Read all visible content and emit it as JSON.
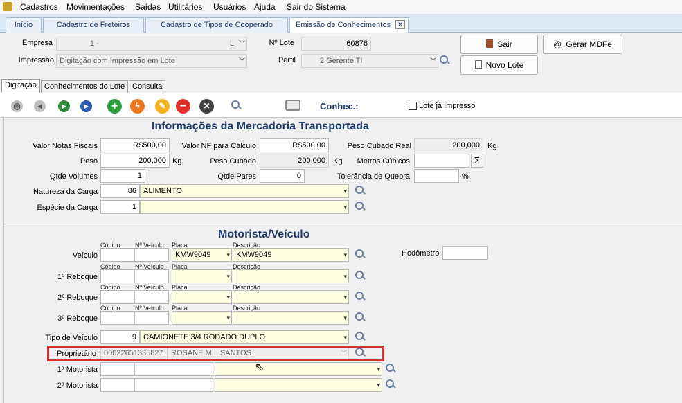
{
  "menu": [
    "Cadastros",
    "Movimentações",
    "Saídas",
    "Utilitários",
    "Usuários",
    "Ajuda",
    "Sair do Sistema"
  ],
  "tabs": [
    "Início",
    "Cadastro de Freteiros",
    "Cadastro de Tipos de Cooperado",
    "Emissão de Conhecimentos"
  ],
  "header": {
    "empresa_label": "Empresa",
    "empresa_code": "1",
    "empresa_name": "-",
    "empresa_suffix": "L",
    "lote_label": "Nº Lote",
    "lote_value": "60876",
    "impressao_label": "Impressão",
    "impressao_value": "Digitação com Impressão em Lote",
    "perfil_label": "Perfil",
    "perfil_code": "2",
    "perfil_value": "Gerente TI",
    "sair_label": "Sair",
    "mdfe_label": "Gerar MDFe",
    "novo_label": "Novo Lote"
  },
  "subtabs": [
    "Digitação",
    "Conhecimentos do Lote",
    "Consulta"
  ],
  "toolbar": {
    "conhec_label": "Conhec.:",
    "lote_impresso_label": "Lote já Impresso"
  },
  "merc": {
    "title": "Informações da Mercadoria Transportada",
    "valor_nf_label": "Valor Notas Fiscais",
    "valor_nf": "R$500,00",
    "valor_calc_label": "Valor NF para Cálculo",
    "valor_calc": "R$500,00",
    "peso_cub_real_label": "Peso Cubado Real",
    "peso_cub_real": "200,000",
    "kg": "Kg",
    "peso_label": "Peso",
    "peso": "200,000",
    "peso_cub_label": "Peso Cubado",
    "peso_cub": "200,000",
    "metros_label": "Metros Cúbicos",
    "metros": "",
    "qtde_vol_label": "Qtde Volumes",
    "qtde_vol": "1",
    "qtde_pares_label": "Qtde Pares",
    "qtde_pares": "0",
    "tol_label": "Tolerância de Quebra",
    "tol": "",
    "pct": "%",
    "natureza_label": "Natureza da Carga",
    "natureza_code": "86",
    "natureza_value": "ALIMENTO",
    "especie_label": "Espécie da Carga",
    "especie_code": "1",
    "especie_value": ""
  },
  "mot": {
    "title": "Motorista/Veículo",
    "cap_codigo": "Código",
    "cap_nveiculo": "Nº Veículo",
    "cap_placa": "Placa",
    "cap_desc": "Descrição",
    "veiculo_label": "Veículo",
    "veiculo_placa": "KMW9049",
    "veiculo_desc": "KMW9049",
    "hodometro_label": "Hodômetro",
    "reb1_label": "1º Reboque",
    "reb2_label": "2º Reboque",
    "reb3_label": "3º Reboque",
    "tipo_label": "Tipo de Veículo",
    "tipo_code": "9",
    "tipo_value": "CAMIONETE 3/4 RODADO DUPLO",
    "prop_label": "Proprietário",
    "prop_code": "00022651335827",
    "prop_name": "ROSANE M... SANTOS",
    "mot1_label": "1º Motorista",
    "mot2_label": "2º Motorista"
  }
}
